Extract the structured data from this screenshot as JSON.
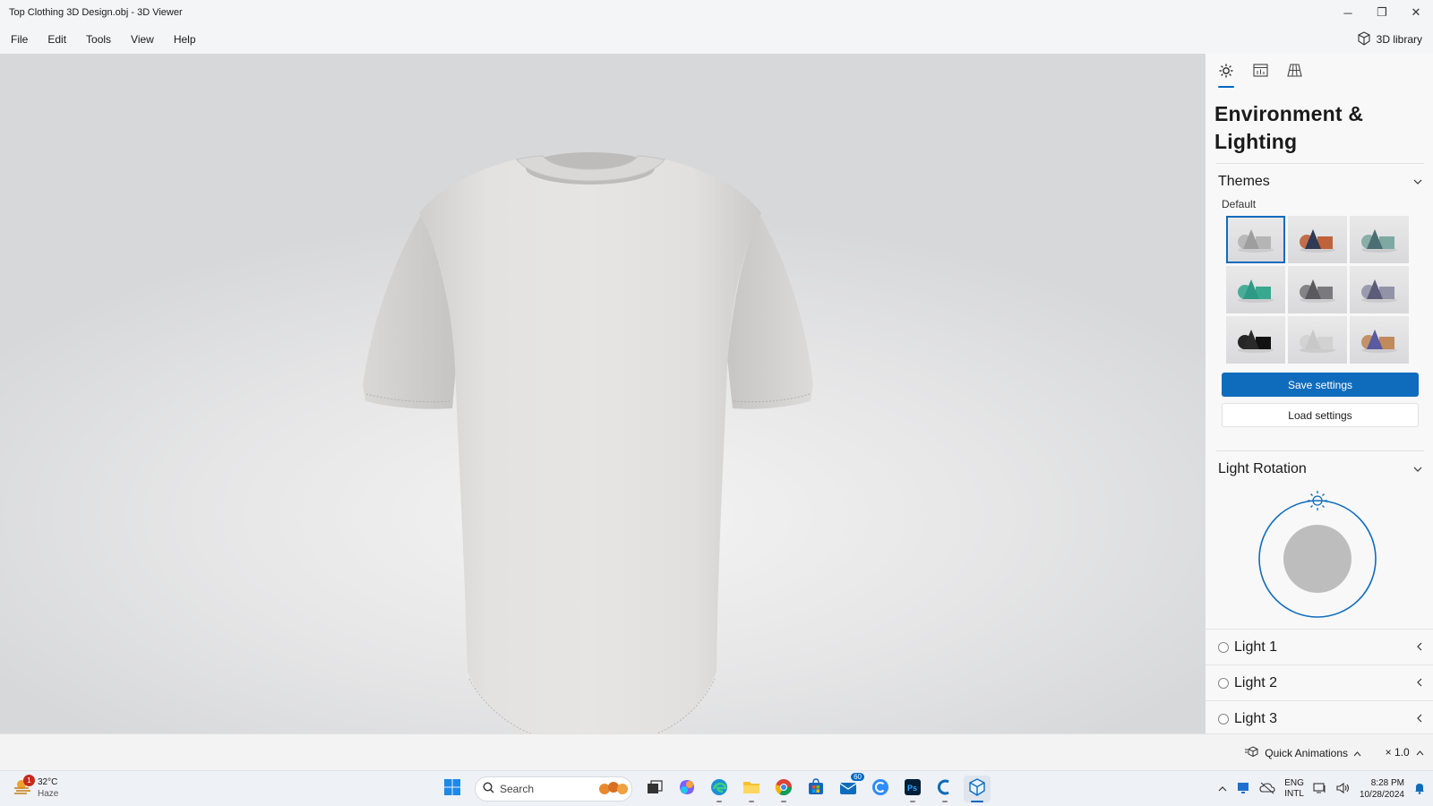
{
  "window": {
    "title": "Top Clothing 3D Design.obj - 3D Viewer",
    "minimize": "─",
    "restore": "❐",
    "close": "✕"
  },
  "menu": {
    "items": [
      "File",
      "Edit",
      "Tools",
      "View",
      "Help"
    ],
    "library_label": "3D library"
  },
  "panel": {
    "tabs": [
      "sun-icon",
      "stats-icon",
      "grid-icon"
    ],
    "title": "Environment & Lighting",
    "themes": {
      "header": "Themes",
      "default_label": "Default",
      "items": [
        {
          "primary": "#9e9e9e",
          "secondary": "#b5b5b5",
          "selected": true
        },
        {
          "primary": "#2f3b55",
          "secondary": "#c0623a",
          "selected": false
        },
        {
          "primary": "#4a6e72",
          "secondary": "#7fa8a2",
          "selected": false
        },
        {
          "primary": "#2e9a86",
          "secondary": "#38a890",
          "selected": false
        },
        {
          "primary": "#5a5a5e",
          "secondary": "#7a7a7e",
          "selected": false
        },
        {
          "primary": "#5b5b7a",
          "secondary": "#9393a8",
          "selected": false
        },
        {
          "primary": "#2a2a2a",
          "secondary": "#111111",
          "selected": false
        },
        {
          "primary": "#c8c8c8",
          "secondary": "#d2d2d2",
          "selected": false
        },
        {
          "primary": "#5a5aa0",
          "secondary": "#c08a5a",
          "selected": false
        }
      ],
      "save_label": "Save settings",
      "load_label": "Load settings"
    },
    "light_rotation": {
      "header": "Light Rotation"
    },
    "lights": [
      {
        "label": "Light 1"
      },
      {
        "label": "Light 2"
      },
      {
        "label": "Light 3"
      }
    ],
    "accent": "#0f6cbd"
  },
  "statusbar": {
    "quick_animations": "Quick Animations",
    "speed": "× 1.0"
  },
  "taskbar": {
    "weather_temp": "32°C",
    "weather_desc": "Haze",
    "weather_badge": "1",
    "search_placeholder": "Search",
    "store_badge": "60",
    "lang_top": "ENG",
    "lang_bottom": "INTL",
    "time": "8:28 PM",
    "date": "10/28/2024"
  }
}
